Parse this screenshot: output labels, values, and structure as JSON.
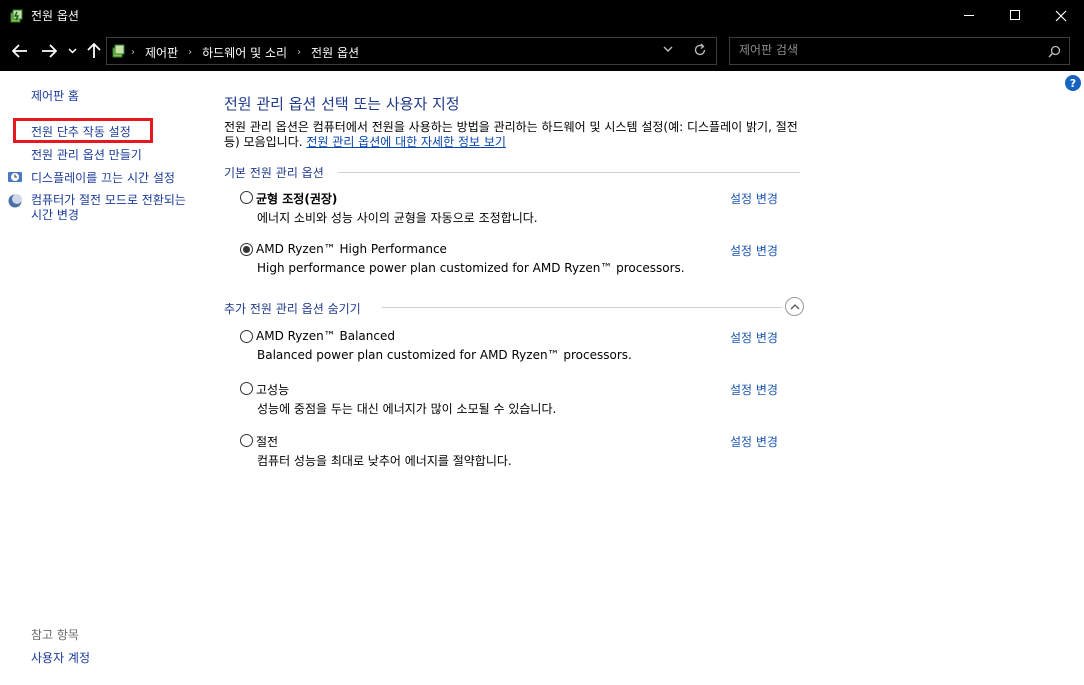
{
  "window": {
    "title": "전원 옵션",
    "controls": {
      "minimize": "minimize-icon",
      "maximize": "maximize-icon",
      "close": "close-icon"
    }
  },
  "address": {
    "breadcrumbs": [
      "제어판",
      "하드웨어 및 소리",
      "전원 옵션"
    ],
    "search_placeholder": "제어판 검색"
  },
  "sidebar": {
    "home": "제어판 홈",
    "links": [
      "전원 단추 작동 설정",
      "전원 관리 옵션 만들기",
      "디스플레이를 끄는 시간 설정",
      "컴퓨터가 절전 모드로 전환되는 시간 변경"
    ],
    "see_also_heading": "참고 항목",
    "see_also": [
      "사용자 계정"
    ]
  },
  "main": {
    "title": "전원 관리 옵션 선택 또는 사용자 지정",
    "description": "전원 관리 옵션은 컴퓨터에서 전원을 사용하는 방법을 관리하는 하드웨어 및 시스템 설정(예: 디스플레이 밝기, 절전 등) 모음입니다.",
    "more_info_link": "전원 관리 옵션에 대한 자세한 정보 보기",
    "preferred_heading": "기본 전원 관리 옵션",
    "additional_heading": "추가 전원 관리 옵션 숨기기",
    "change_label": "설정 변경",
    "preferred_plans": [
      {
        "name": "균형 조정(권장)",
        "desc": "에너지 소비와 성능 사이의 균형을 자동으로 조정합니다.",
        "selected": false
      },
      {
        "name": "AMD Ryzen™ High Performance",
        "desc": "High performance power plan customized for AMD Ryzen™ processors.",
        "selected": true
      }
    ],
    "additional_plans": [
      {
        "name": "AMD Ryzen™ Balanced",
        "desc": "Balanced power plan customized for AMD Ryzen™ processors.",
        "selected": false
      },
      {
        "name": "고성능",
        "desc": "성능에 중점을 두는 대신 에너지가 많이 소모될 수 있습니다.",
        "selected": false
      },
      {
        "name": "절전",
        "desc": "컴퓨터 성능을 최대로 낮추어 에너지를 절약합니다.",
        "selected": false
      }
    ]
  },
  "colors": {
    "accent": "#1e3a8a",
    "highlight": "#e5171f",
    "link": "#0645ad"
  }
}
